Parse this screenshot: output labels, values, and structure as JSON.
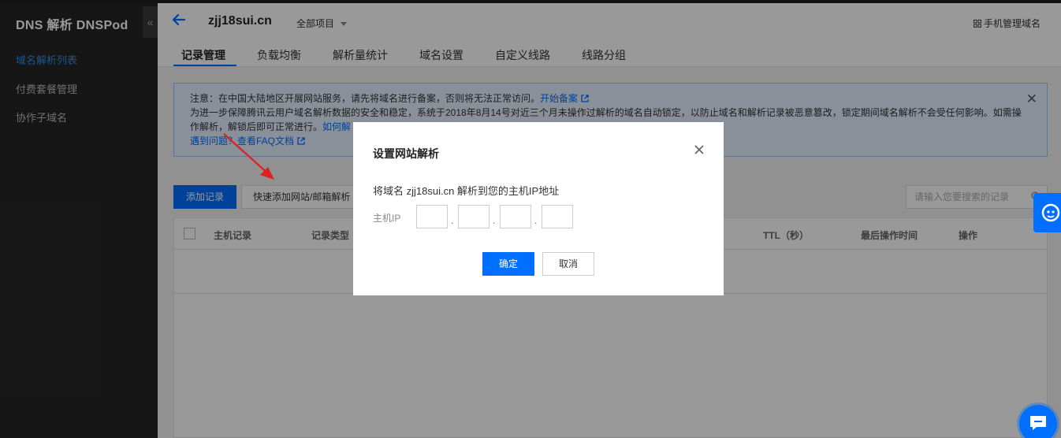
{
  "sidebar": {
    "brand": "DNS 解析 DNSPod",
    "collapse_glyph": "«",
    "items": [
      {
        "label": "域名解析列表",
        "active": true
      },
      {
        "label": "付费套餐管理",
        "active": false
      },
      {
        "label": "协作子域名",
        "active": false
      }
    ]
  },
  "header": {
    "domain": "zjj18sui.cn",
    "project": "全部项目",
    "mobile_manage": "手机管理域名",
    "tabs": [
      {
        "label": "记录管理",
        "active": true
      },
      {
        "label": "负载均衡"
      },
      {
        "label": "解析量统计"
      },
      {
        "label": "域名设置"
      },
      {
        "label": "自定义线路"
      },
      {
        "label": "线路分组"
      }
    ]
  },
  "notice": {
    "line1": "注意：在中国大陆地区开展网站服务，请先将域名进行备案，否则将无法正常访问。",
    "line1_link": "开始备案",
    "line2": "为进一步保障腾讯云用户域名解析数据的安全和稳定，系统于2018年8月14号对近三个月未操作过解析的域名自动锁定，以防止域名和解析记录被恶意篡改，锁定期间域名解析不会受任何影响。如需操",
    "line3": "作解析，解锁后即可正常进行。",
    "line3_link": "如何解",
    "line4_link": "遇到问题？查看FAQ文档",
    "close_glyph": "✕"
  },
  "toolbar": {
    "add_record": "添加记录",
    "quick_add": "快速添加网站/邮箱解析",
    "search_placeholder": "请输入您要搜索的记录"
  },
  "table": {
    "columns": [
      "主机记录",
      "记录类型",
      "TTL（秒）",
      "最后操作时间",
      "操作"
    ]
  },
  "modal": {
    "title": "设置网站解析",
    "description": "将域名 zjj18sui.cn 解析到您的主机IP地址",
    "ip_label": "主机IP",
    "ip_separator": ".",
    "ok": "确定",
    "cancel": "取消"
  },
  "colors": {
    "primary": "#006eff",
    "sidebar_bg": "#262626",
    "annotation_arrow": "#e02020"
  }
}
